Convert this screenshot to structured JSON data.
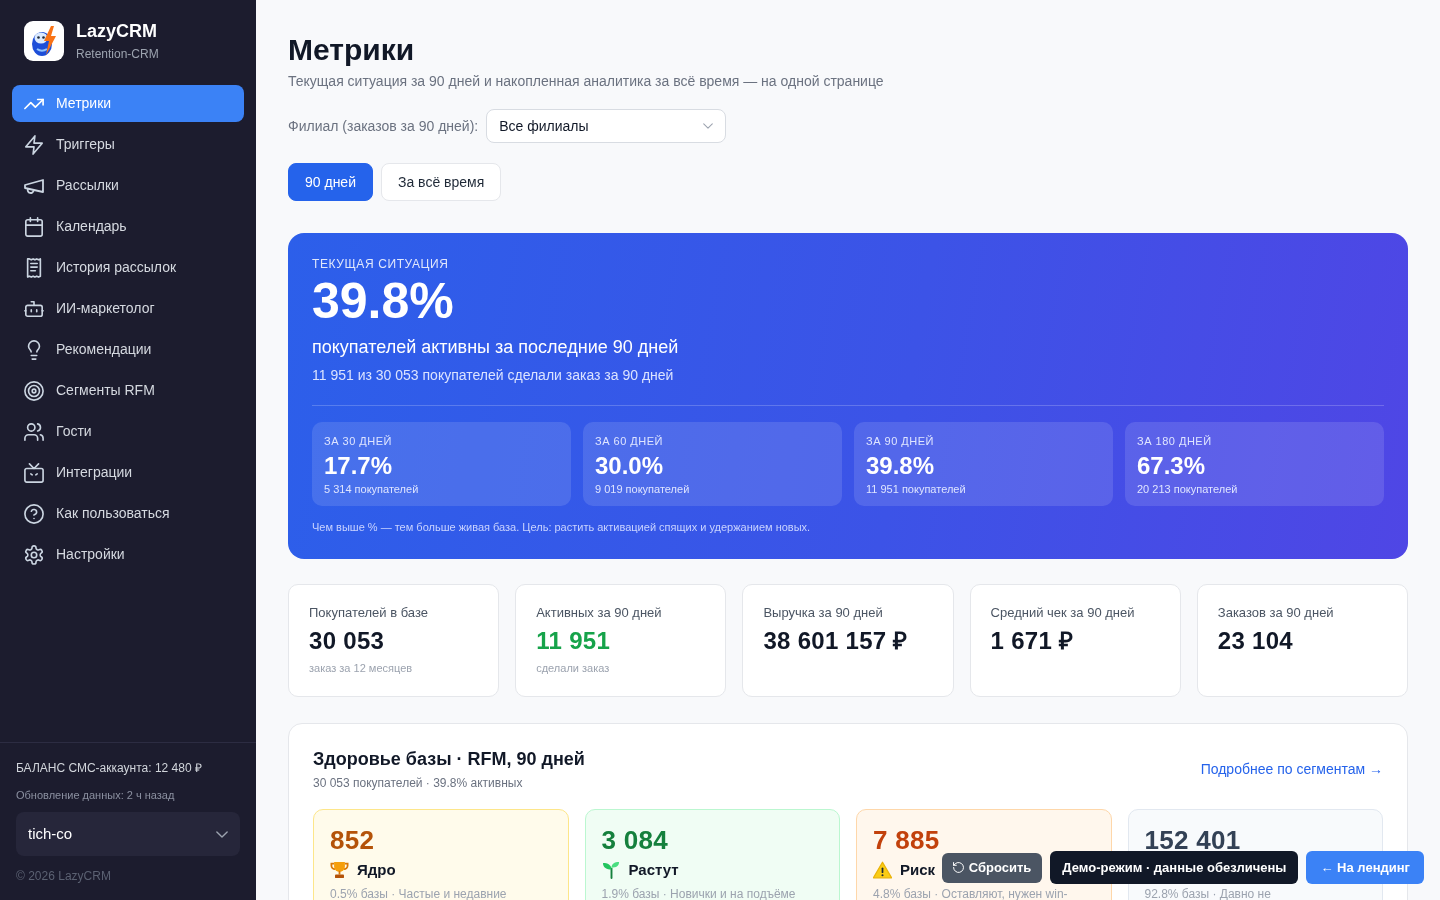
{
  "sidebar": {
    "brand": {
      "name": "LazyCRM",
      "tagline": "Retention-CRM"
    },
    "items": [
      {
        "label": "Метрики",
        "selected": true
      },
      {
        "label": "Триггеры",
        "selected": false
      },
      {
        "label": "Рассылки",
        "selected": false
      },
      {
        "label": "Календарь",
        "selected": false
      },
      {
        "label": "История рассылок",
        "selected": false
      },
      {
        "label": "ИИ-маркетолог",
        "selected": false
      },
      {
        "label": "Рекомендации",
        "selected": false
      },
      {
        "label": "Сегменты RFM",
        "selected": false
      },
      {
        "label": "Гости",
        "selected": false
      },
      {
        "label": "Интеграции",
        "selected": false
      },
      {
        "label": "Как пользоваться",
        "selected": false
      },
      {
        "label": "Настройки",
        "selected": false
      }
    ],
    "balance": "БАЛАНС СМС-аккаунта: 12 480 ₽",
    "updated": "Обновление данных: 2 ч назад",
    "account_select": {
      "value": "tich-co"
    },
    "copyright": "© 2026 LazyCRM"
  },
  "header": {
    "title": "Метрики",
    "subtitle": "Текущая ситуация за 90 дней и накопленная аналитика за всё время — на одной странице"
  },
  "filter": {
    "label": "Филиал (заказов за 90 дней):",
    "value": "Все филиалы"
  },
  "period_tabs": [
    {
      "label": "90 дней",
      "selected": true
    },
    {
      "label": "За всё время",
      "selected": false
    }
  ],
  "hero": {
    "eyebrow": "ТЕКУЩАЯ СИТУАЦИЯ",
    "value": "39.8%",
    "headline": "покупателей активны за последние 90 дней",
    "detail": "11 951 из 30 053 покупателей сделали заказ за 90 дней",
    "periods": [
      {
        "label": "ЗА 30 ДНЕЙ",
        "value": "17.7%",
        "caption": "5 314 покупателей"
      },
      {
        "label": "ЗА 60 ДНЕЙ",
        "value": "30.0%",
        "caption": "9 019 покупателей"
      },
      {
        "label": "ЗА 90 ДНЕЙ",
        "value": "39.8%",
        "caption": "11 951 покупателей"
      },
      {
        "label": "ЗА 180 ДНЕЙ",
        "value": "67.3%",
        "caption": "20 213 покупателей"
      }
    ],
    "note": "Чем выше % — тем больше живая база. Цель: растить активацией спящих и удержанием новых."
  },
  "stats": [
    {
      "label": "Покупателей в базе",
      "value": "30 053",
      "caption": "заказ за 12 месяцев",
      "accent": false
    },
    {
      "label": "Активных за 90 дней",
      "value": "11 951",
      "caption": "сделали заказ",
      "accent": true
    },
    {
      "label": "Выручка за 90 дней",
      "value": "38 601 157 ₽",
      "accent": false
    },
    {
      "label": "Средний чек за 90 дней",
      "value": "1 671 ₽",
      "accent": false
    },
    {
      "label": "Заказов за 90 дней",
      "value": "23 104",
      "accent": false
    }
  ],
  "health": {
    "title": "Здоровье базы · RFM, 90 дней",
    "subtitle": "30 053 покупателей · 39.8% активных",
    "link": "Подробнее по сегментам →",
    "segments": [
      {
        "kind": "core",
        "value": "852",
        "label": "Ядро",
        "description": "0.5% базы · Частые и недавние",
        "color": "#b45309"
      },
      {
        "kind": "growing",
        "value": "3 084",
        "label": "Растут",
        "description": "1.9% базы · Новички и на подъёме",
        "color": "#15803d"
      },
      {
        "kind": "risk",
        "value": "7 885",
        "label": "Риск",
        "description": "4.8% базы · Оставляют, нужен win-",
        "color": "#c2410c"
      },
      {
        "kind": "other",
        "value": "152 401",
        "description": "92.8% базы · Давно не",
        "color": "#334155"
      }
    ]
  },
  "floating_actions": {
    "reset": "Сбросить",
    "badge": "Демо-режим · данные обезличены",
    "landing": "← На лендинг"
  }
}
